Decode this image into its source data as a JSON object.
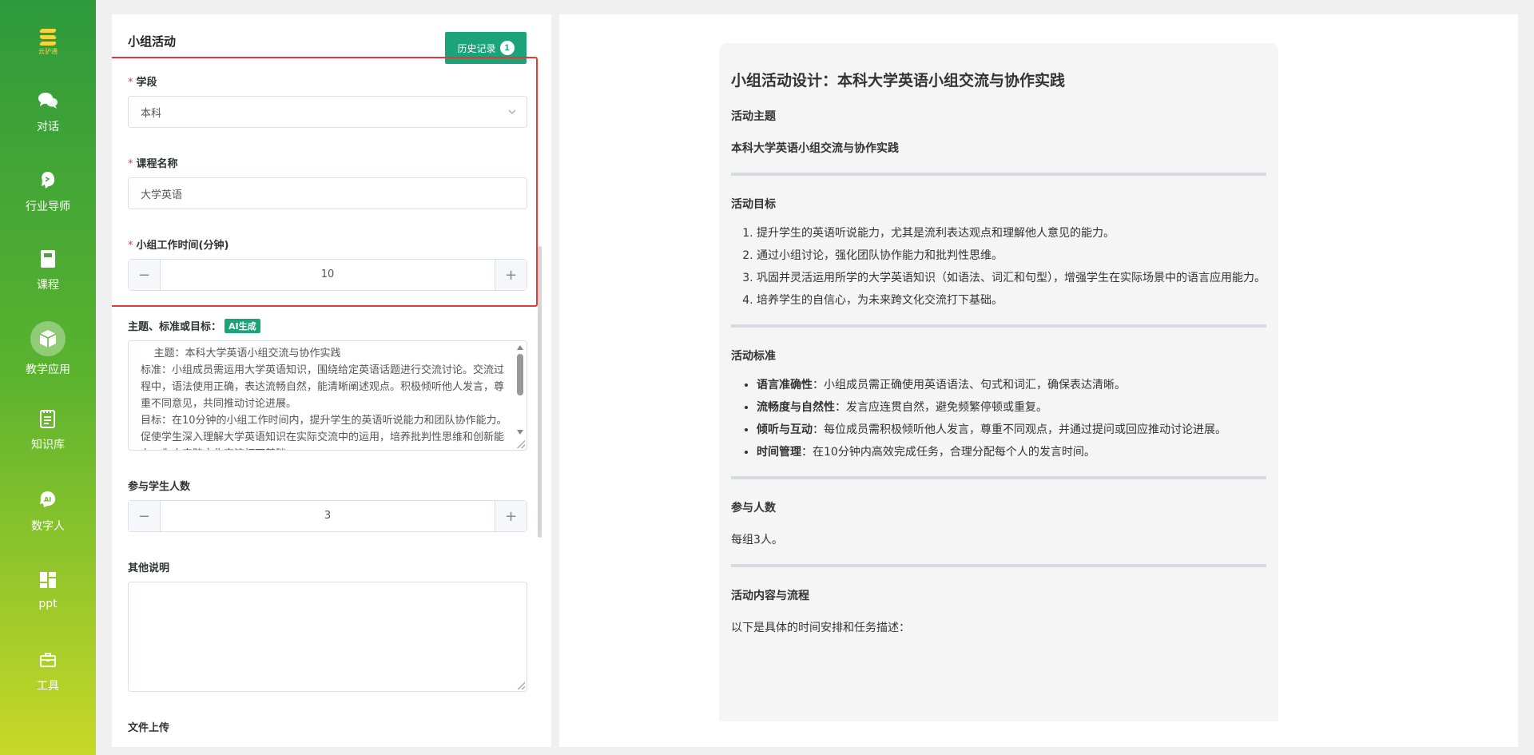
{
  "sidebar": {
    "logo_text": "云驴通",
    "items": [
      {
        "label": "对话",
        "icon": "chat-icon"
      },
      {
        "label": "行业导师",
        "icon": "mentor-icon"
      },
      {
        "label": "课程",
        "icon": "book-icon"
      },
      {
        "label": "教学应用",
        "icon": "cube-icon",
        "active": true
      },
      {
        "label": "知识库",
        "icon": "document-icon"
      },
      {
        "label": "数字人",
        "icon": "ai-avatar-icon"
      },
      {
        "label": "ppt",
        "icon": "layout-icon"
      },
      {
        "label": "工具",
        "icon": "toolbox-icon"
      }
    ]
  },
  "form": {
    "title": "小组活动",
    "history_label": "历史记录",
    "history_count": "1",
    "stage_label": "学段",
    "stage_value": "本科",
    "course_label": "课程名称",
    "course_value": "大学英语",
    "time_label": "小组工作时间(分钟)",
    "time_value": "10",
    "theme_label": "主题、标准或目标：",
    "ai_tag": "AI生成",
    "theme_text": "    主题：本科大学英语小组交流与协作实践\n标准：小组成员需运用大学英语知识，围绕给定英语话题进行交流讨论。交流过程中，语法使用正确，表达流畅自然，能清晰阐述观点。积极倾听他人发言，尊重不同意见，共同推动讨论进展。\n目标：在10分钟的小组工作时间内，提升学生的英语听说能力和团队协作能力。促使学生深入理解大学英语知识在实际交流中的运用，培养批判性思维和创新能力，为未来跨文化交流打下基础。",
    "students_label": "参与学生人数",
    "students_value": "3",
    "notes_label": "其他说明",
    "upload_label": "文件上传"
  },
  "output": {
    "title": "小组活动设计：本科大学英语小组交流与协作实践",
    "theme_heading": "活动主题",
    "theme": "本科大学英语小组交流与协作实践",
    "goals_heading": "活动目标",
    "goals": [
      "提升学生的英语听说能力，尤其是流利表达观点和理解他人意见的能力。",
      "通过小组讨论，强化团队协作能力和批判性思维。",
      "巩固并灵活运用所学的大学英语知识（如语法、词汇和句型），增强学生在实际场景中的语言应用能力。",
      "培养学生的自信心，为未来跨文化交流打下基础。"
    ],
    "standards_heading": "活动标准",
    "standards": [
      {
        "term": "语言准确性",
        "desc": "：小组成员需正确使用英语语法、句式和词汇，确保表达清晰。"
      },
      {
        "term": "流畅度与自然性",
        "desc": "：发言应连贯自然，避免频繁停顿或重复。"
      },
      {
        "term": "倾听与互动",
        "desc": "：每位成员需积极倾听他人发言，尊重不同观点，并通过提问或回应推动讨论进展。"
      },
      {
        "term": "时间管理",
        "desc": "：在10分钟内高效完成任务，合理分配每个人的发言时间。"
      }
    ],
    "participants_heading": "参与人数",
    "participants": "每组3人。",
    "flow_heading": "活动内容与流程",
    "flow_intro": "以下是具体的时间安排和任务描述："
  }
}
